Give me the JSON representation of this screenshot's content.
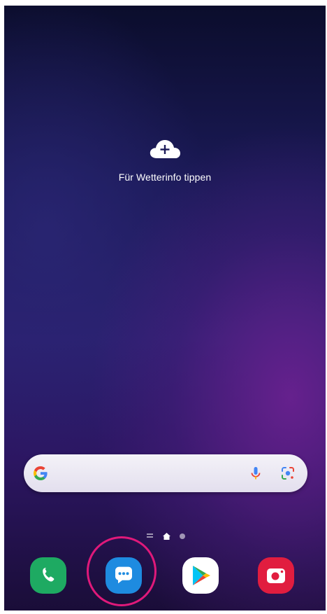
{
  "weather_widget": {
    "icon": "cloud-plus-icon",
    "label": "Für Wetterinfo tippen"
  },
  "search_bar": {
    "icons": [
      "google-g-icon",
      "microphone-icon",
      "google-lens-icon"
    ]
  },
  "page_indicator": {
    "pages": [
      "apps-list",
      "home",
      "page-2"
    ],
    "current": "home"
  },
  "dock": {
    "apps": [
      {
        "name": "Phone",
        "icon": "phone-icon",
        "color": "#1eaa62"
      },
      {
        "name": "Messages",
        "icon": "messages-icon",
        "color": "#1e8be0",
        "highlighted": true
      },
      {
        "name": "Play Store",
        "icon": "play-store-icon",
        "color": "#ffffff"
      },
      {
        "name": "Camera",
        "icon": "camera-icon",
        "color": "#e11d3f"
      }
    ]
  },
  "colors": {
    "highlight_ring": "#e0197a",
    "wallpaper_top": "#0b0d2c",
    "wallpaper_bottom": "#2c1662"
  }
}
